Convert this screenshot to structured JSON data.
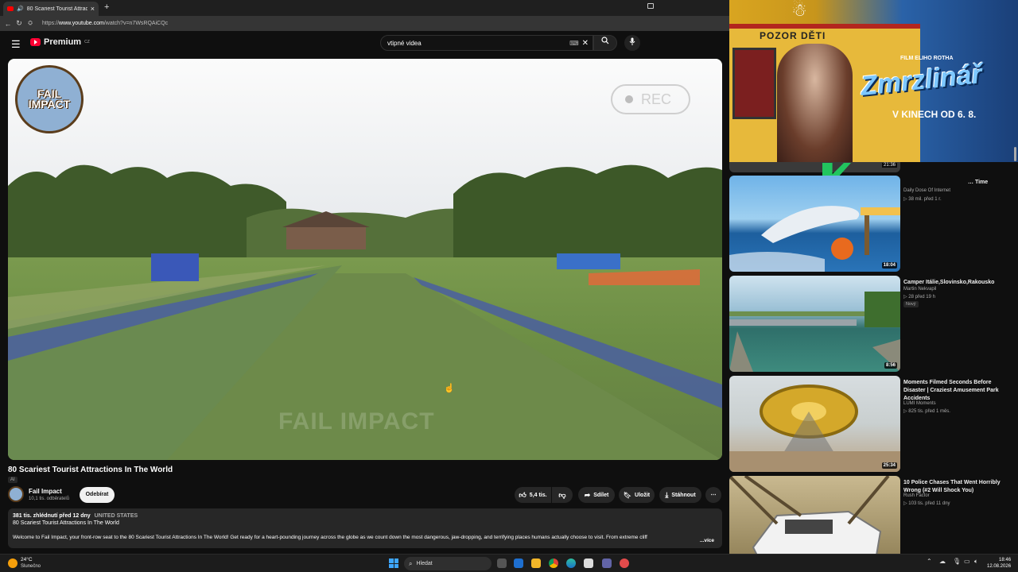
{
  "browser": {
    "tab_title": "80 Scariest Tourist Attractions",
    "tab_close": "×",
    "new_tab": "+",
    "url_prefix": "https://",
    "url_host": "www.youtube.com",
    "url_path": "/watch?v=n7WsRQAiCQc"
  },
  "masthead": {
    "logo_text": "Premium",
    "logo_sup": "CZ",
    "search_value": "vtipné videa",
    "search_kbd": "⌨",
    "search_clear": "✕"
  },
  "player": {
    "watermark_logo_line1": "FAIL",
    "watermark_logo_line2": "IMPACT",
    "rec_label": "REC",
    "watermark_text": "FAIL IMPACT"
  },
  "video": {
    "title": "80 Scariest Tourist Attractions In The World",
    "ai_badge": "AI",
    "channel_name": "Fail Impact",
    "channel_subs": "10,1 tis. odběratelů",
    "unsubscribe_label": "Odebírat",
    "like_count": "5,4 tis.",
    "share_label": "Sdílet",
    "save_label": "Uložit",
    "download_label": "Stáhnout",
    "more_label": "⋯"
  },
  "description": {
    "views_date": "381 tis. zhlédnutí  před 12 dny",
    "country": "UNITED STATES",
    "headline": "80 Scariest Tourist Attractions In The World",
    "body": "Welcome to Fail Impact, your front-row seat to the 80 Scariest Tourist Attractions In The World! Get ready for a heart-pounding journey across the globe as we count down the most dangerous, jaw-dropping, and terrifying places humans actually choose to visit. From extreme cliff",
    "more": "...více"
  },
  "ad": {
    "pozor": "POZOR DĚTI",
    "film_label": "FILM ELIHO ROTHA",
    "brand": "Zmrzlinář",
    "date": "V KINECH OD 6. 8."
  },
  "recommendations": {
    "partial": {
      "duration": "21:36",
      "title": "… Time",
      "channel": "Daily Dose Of Internet",
      "stats": "▷ 38 mil.  před 1 r."
    },
    "items": [
      {
        "duration": "18:04",
        "title": "",
        "channel": "",
        "stats": ""
      },
      {
        "duration": "8:56",
        "title": "Camper Itálie,Slovinsko,Rakousko",
        "channel": "Martin Nekvapil",
        "stats": "▷ 28  před 19 h",
        "badge": "Nový"
      },
      {
        "duration": "25:34",
        "title": "Moments Filmed Seconds Before Disaster | Craziest Amusement Park Accidents",
        "channel": "LUMI Moments",
        "stats": "▷ 825 tis.  před 1 měs."
      },
      {
        "duration": "",
        "title": "10 Police Chases That Went Horribly Wrong (#2 Will Shock You)",
        "channel": "Rush Factor",
        "stats": "▷ 103 tis.  před 11 dny"
      }
    ]
  },
  "taskbar": {
    "temperature": "24°C",
    "condition": "Slunečno",
    "search_label": "Hledat",
    "time": "18:46",
    "date": "12.08.2026"
  },
  "colors": {
    "yt_red": "#ff0033",
    "bg": "#0f0f0f",
    "pill": "#272727"
  }
}
